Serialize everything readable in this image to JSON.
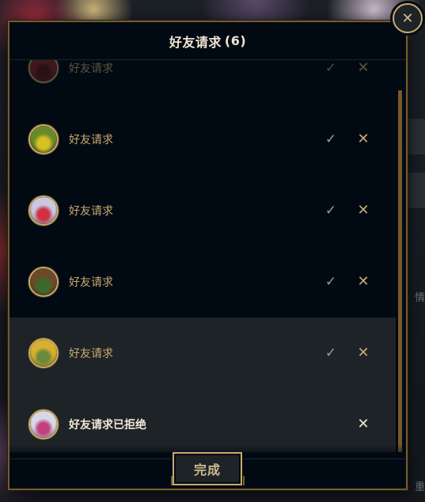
{
  "dialog": {
    "title": "好友请求",
    "count": "(6)",
    "done_label": "完成",
    "close_glyph": "✕"
  },
  "requests": [
    {
      "label": "好友请求",
      "avatar_color": "#8a2a2a",
      "accent": "#5a1a1a",
      "accept_glyph": "✓",
      "decline_glyph": "✕",
      "state": "pending"
    },
    {
      "label": "好友请求",
      "avatar_color": "#6a8a2a",
      "accent": "#d8c020",
      "accept_glyph": "✓",
      "decline_glyph": "✕",
      "state": "pending"
    },
    {
      "label": "好友请求",
      "avatar_color": "#c8c8e0",
      "accent": "#d03040",
      "accept_glyph": "✓",
      "decline_glyph": "✕",
      "state": "pending"
    },
    {
      "label": "好友请求",
      "avatar_color": "#6a4a2a",
      "accent": "#3a6a2a",
      "accept_glyph": "✓",
      "decline_glyph": "✕",
      "state": "pending"
    },
    {
      "label": "好友请求",
      "avatar_color": "#d8b030",
      "accent": "#6a8a3a",
      "accept_glyph": "✓",
      "decline_glyph": "✕",
      "state": "pending"
    },
    {
      "label": "好友请求已拒绝",
      "avatar_color": "#d8d8e8",
      "accent": "#c04080",
      "accept_glyph": "",
      "decline_glyph": "✕",
      "state": "declined"
    }
  ],
  "background": {
    "side_text_1": "情",
    "side_text_2": "重"
  },
  "colors": {
    "gold": "#c8aa6e",
    "border": "#785a28",
    "panel": "#010a13",
    "highlight_row": "#1e2328"
  }
}
